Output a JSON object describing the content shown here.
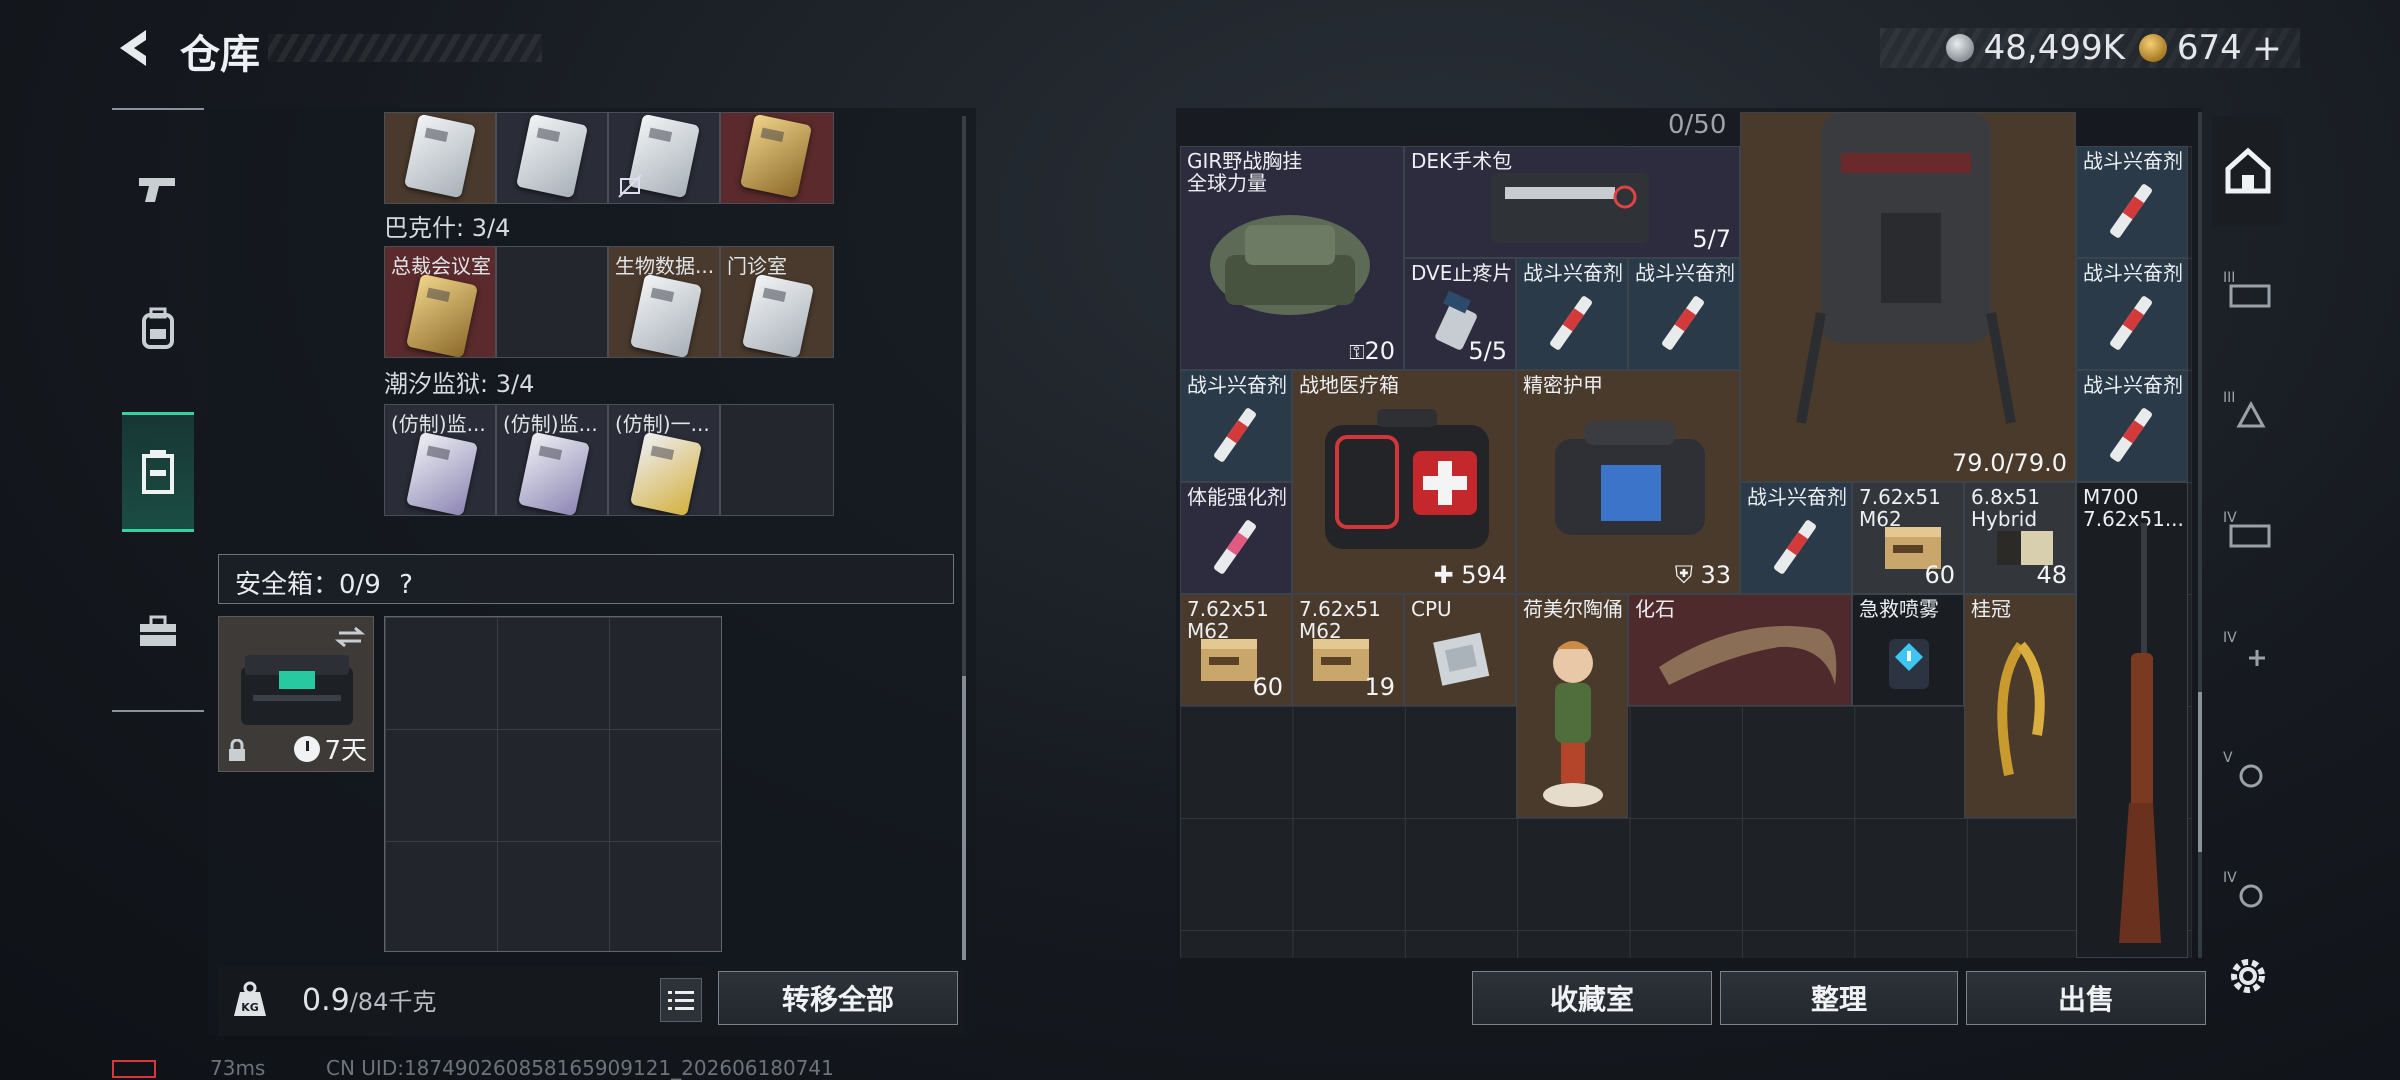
{
  "header": {
    "title": "仓库",
    "currency": {
      "silver": "48,499K",
      "gold": "674",
      "gold_add": "+"
    }
  },
  "left_nav": {
    "items": [
      "weapons",
      "backpack",
      "storage",
      "toolbox"
    ],
    "active": "storage"
  },
  "storage": {
    "section_bakeshi": "巴克什: 3/4",
    "section_chaoxi": "潮汐监狱: 3/4",
    "bakeshi_cells": [
      "总裁会议室",
      "",
      "生物数据...",
      "门诊室"
    ],
    "chaoxi_cells": [
      "(仿制)监...",
      "(仿制)监...",
      "(仿制)一...",
      ""
    ],
    "safe_title": "安全箱：0/9",
    "safe_help": "?",
    "safe_timer": "7天"
  },
  "footer_left": {
    "weight": "0.9",
    "weight_max": "/84千克",
    "transfer_all": "转移全部"
  },
  "inventory": {
    "capacity": "0/50",
    "items": {
      "vest_name": "GIR野战胸挂",
      "vest_sub": "全球力量",
      "vest_qty": "20",
      "dek_name": "DEK手术包",
      "dek_qty": "5/7",
      "dve_name": "DVE止疼片",
      "dve_qty": "5/5",
      "stim": "战斗兴奋剂",
      "armor_qty": "79.0/79.0",
      "field_med": "战地医疗箱",
      "field_med_qty": "594",
      "precise_armor": "精密护甲",
      "precise_armor_qty": "33",
      "stamina": "体能强化剂",
      "ammo762": "7.62x51",
      "ammo762_sub": "M62",
      "ammo762_qty": "60",
      "ammo68": "6.8x51",
      "ammo68_sub": "Hybrid",
      "ammo68_qty": "48",
      "m700": "M700",
      "m700_sub": "7.62x51...",
      "ammo762_b_qty": "60",
      "ammo762_c_qty": "19",
      "cpu": "CPU",
      "hummel": "荷美尔陶俑",
      "fossil": "化石",
      "spray": "急救喷雾",
      "laurel": "桂冠"
    }
  },
  "footer_right": {
    "collection": "收藏室",
    "sort": "整理",
    "sell": "出售"
  },
  "status": {
    "ping": "73ms",
    "uid": "CN UID:18749026085816590912​1_202606180741"
  },
  "colors": {
    "accent": "#38d0a0",
    "stim_bg": "#2a3a48",
    "danger": "#d8373b"
  }
}
